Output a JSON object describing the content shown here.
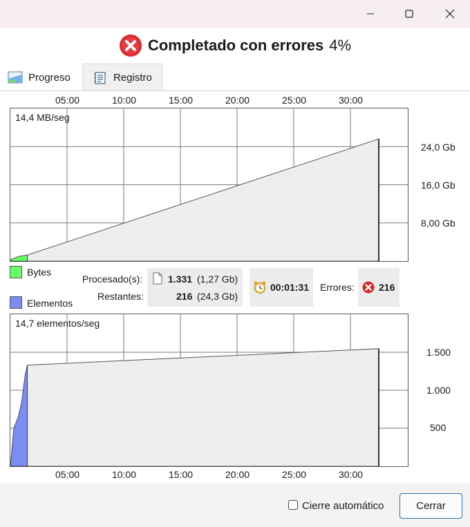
{
  "header": {
    "title": "Completado con errores",
    "percent": "4%"
  },
  "tabs": [
    {
      "label": "Progreso"
    },
    {
      "label": "Registro"
    }
  ],
  "time_ticks": [
    "05:00",
    "10:00",
    "15:00",
    "20:00",
    "25:00",
    "30:00"
  ],
  "bytes_chart": {
    "speed_label": "14,4 MB/seg",
    "y_tick_labels": [
      "24,0 Gb",
      "16,0 Gb",
      "8,00 Gb"
    ]
  },
  "items_chart": {
    "speed_label": "14,7 elementos/seg",
    "y_tick_labels": [
      "1.500",
      "1.000",
      "500"
    ]
  },
  "legend": {
    "bytes": "Bytes",
    "items": "Elementos",
    "bytes_color": "#66ff66",
    "items_color": "#7b8cf5"
  },
  "stats": {
    "processed_label": "Procesado(s):",
    "processed_count": "1.331",
    "processed_size": "(1,27 Gb)",
    "remaining_label": "Restantes:",
    "remaining_count": "216",
    "remaining_size": "(24,3 Gb)",
    "elapsed_time": "00:01:31",
    "errors_label": "Errores:",
    "errors_count": "216"
  },
  "footer": {
    "auto_close_label": "Cierre automático",
    "close_button": "Cerrar"
  },
  "chart_data": [
    {
      "type": "area",
      "title": "",
      "xlabel": "",
      "ylabel": "",
      "x_ticks": [
        "05:00",
        "10:00",
        "15:00",
        "20:00",
        "25:00",
        "30:00"
      ],
      "y_ticks": [
        8.0,
        16.0,
        24.0
      ],
      "y_unit": "Gb",
      "ylim": [
        0,
        32
      ],
      "series": [
        {
          "name": "Bytes",
          "values": [
            [
              0,
              0.3
            ],
            [
              0.75,
              1.0
            ],
            [
              1.5,
              1.27
            ]
          ]
        },
        {
          "values": [
            [
              1.5,
              1.27
            ],
            [
              32.5,
              25.6
            ]
          ]
        }
      ]
    },
    {
      "type": "area",
      "title": "",
      "xlabel": "",
      "ylabel": "",
      "x_ticks": [
        "05:00",
        "10:00",
        "15:00",
        "20:00",
        "25:00",
        "30:00"
      ],
      "y_ticks": [
        500,
        1000,
        1500
      ],
      "ylim": [
        0,
        2000
      ],
      "series": [
        {
          "name": "Elementos",
          "values": [
            [
              0,
              0
            ],
            [
              0.3,
              500
            ],
            [
              0.7,
              650
            ],
            [
              1.0,
              850
            ],
            [
              1.3,
              1200
            ],
            [
              1.5,
              1331
            ]
          ]
        },
        {
          "values": [
            [
              1.5,
              1331
            ],
            [
              32.5,
              1547
            ]
          ]
        }
      ]
    }
  ]
}
